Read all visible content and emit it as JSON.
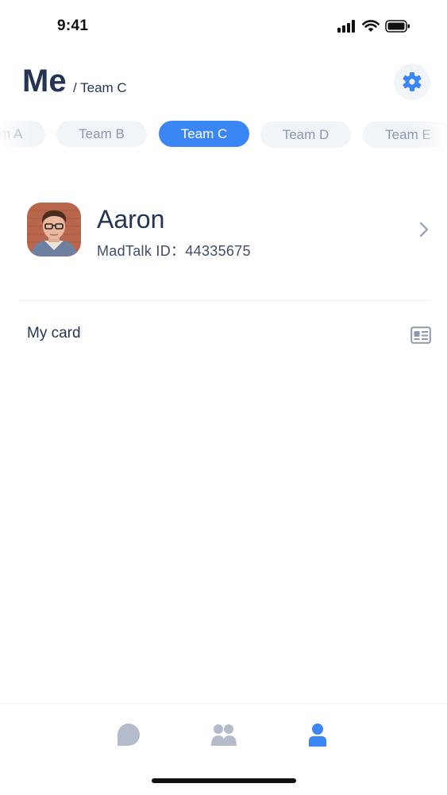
{
  "status_bar": {
    "time": "9:41"
  },
  "header": {
    "title": "Me",
    "subtitle": "/ Team C"
  },
  "tabs": [
    {
      "label": "Team A",
      "active": false
    },
    {
      "label": "Team B",
      "active": false
    },
    {
      "label": "Team C",
      "active": true
    },
    {
      "label": "Team D",
      "active": false
    },
    {
      "label": "Team E",
      "active": false
    }
  ],
  "profile": {
    "name": "Aaron",
    "id_label": "MadTalk ID：",
    "id_value": "44335675"
  },
  "card": {
    "label": "My card"
  },
  "nav": {
    "items": [
      "chat-icon",
      "contacts-icon",
      "me-icon"
    ],
    "active": "me-icon"
  },
  "colors": {
    "accent": "#3a86f5",
    "text": "#253454",
    "muted": "#b4bccb"
  }
}
